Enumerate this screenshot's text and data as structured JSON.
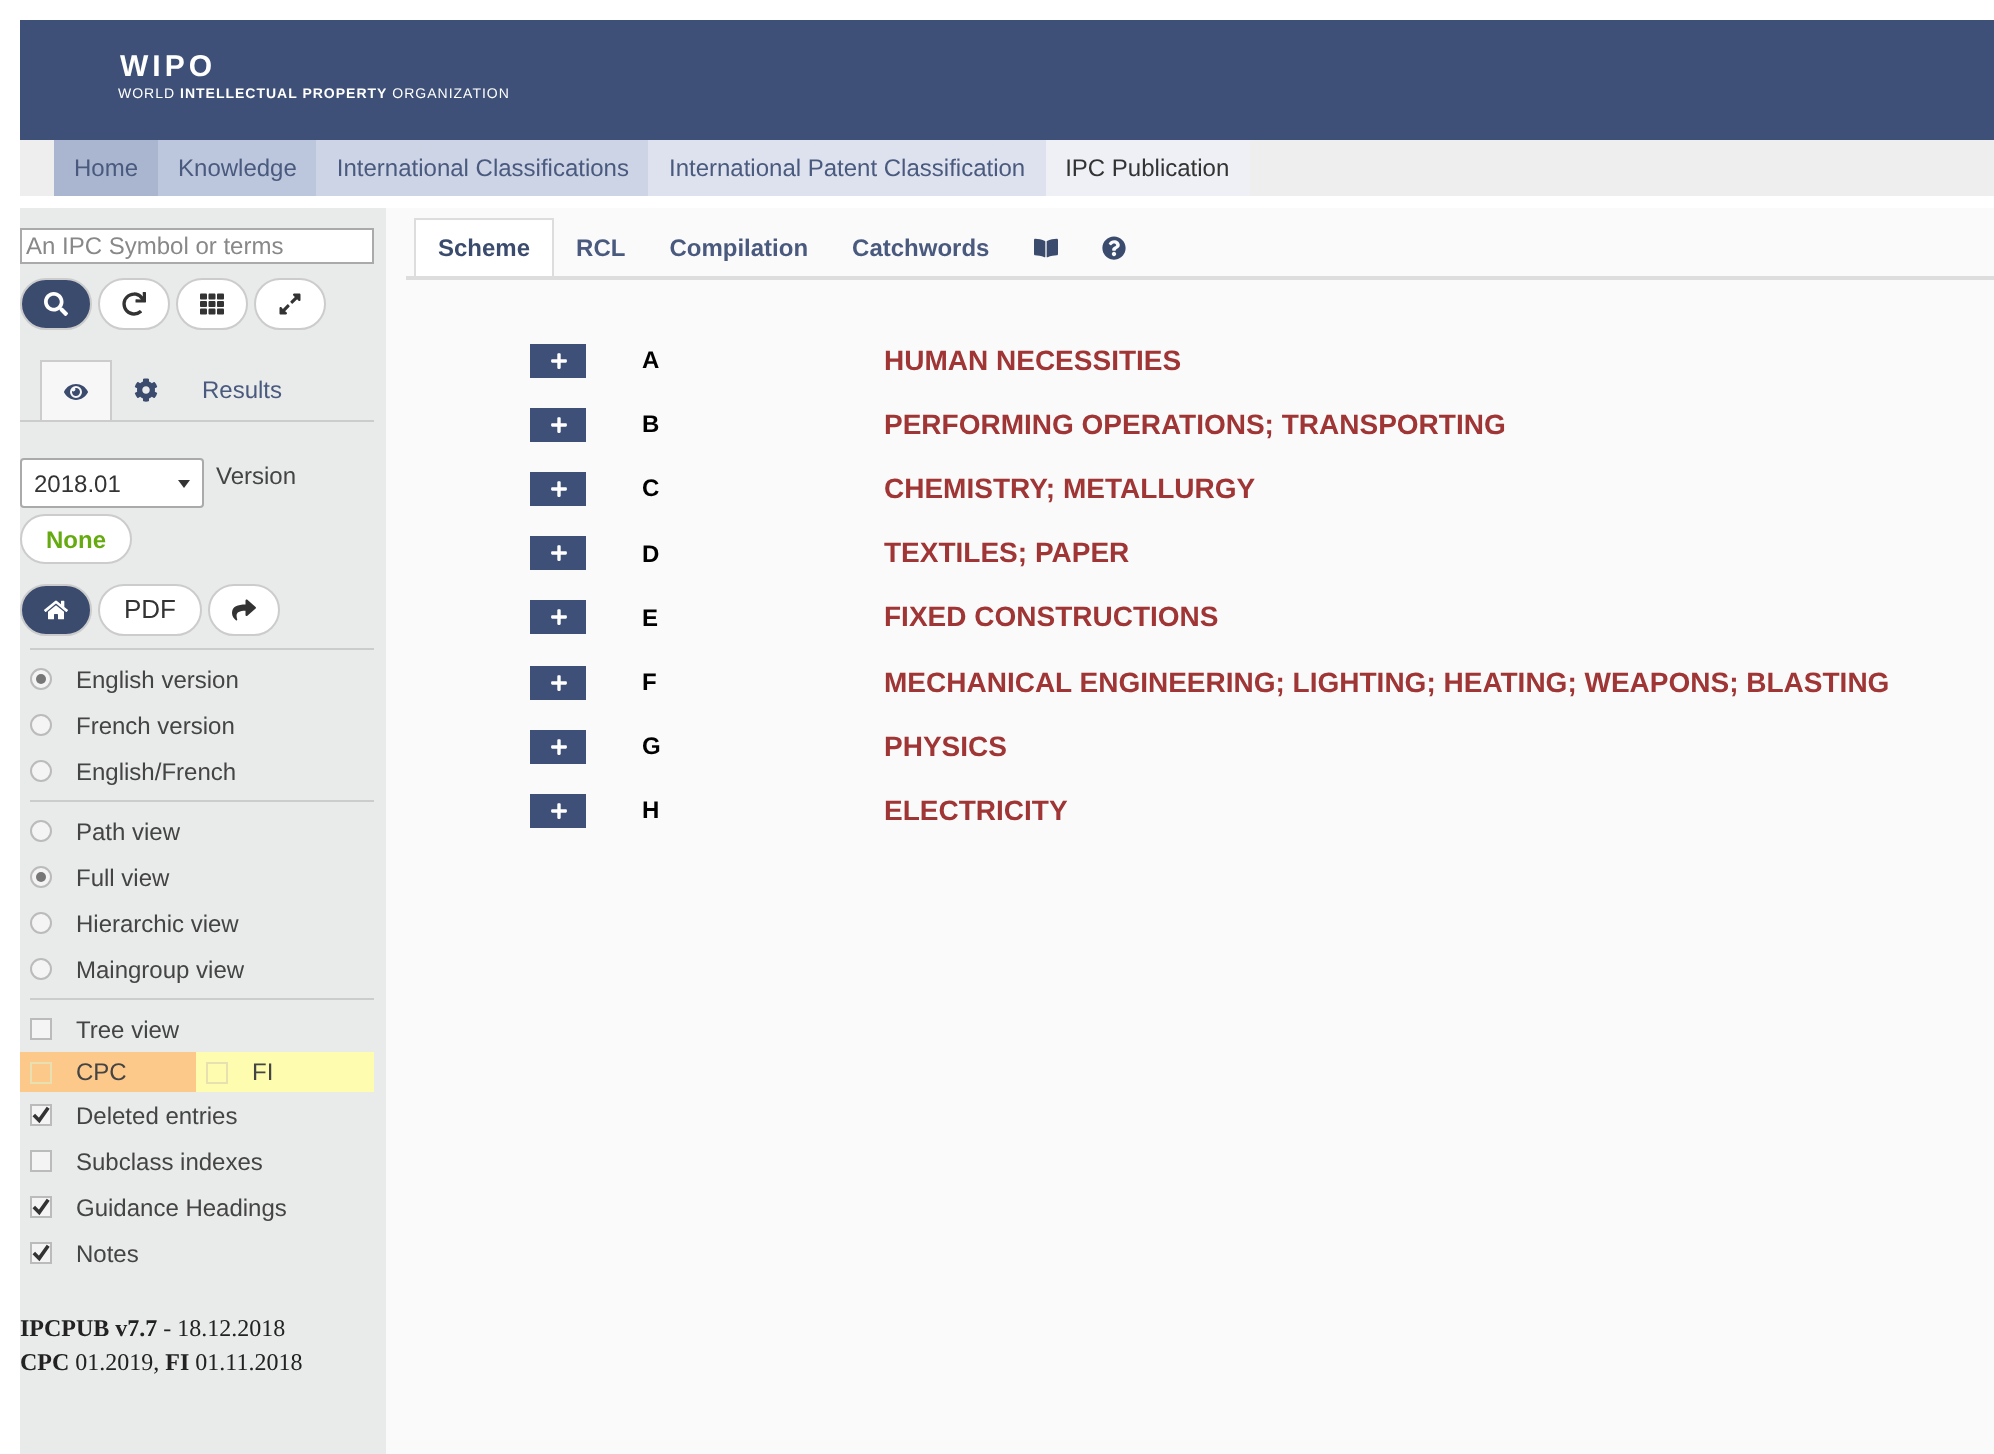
{
  "header": {
    "logo": "WIPO",
    "org": "WORLD **INTELLECTUAL PROPERTY** ORGANIZATION"
  },
  "nav": [
    {
      "label": "Home",
      "color": "#aab6d0",
      "selected": false
    },
    {
      "label": "Knowledge",
      "color": "#bcc6dc",
      "selected": false
    },
    {
      "label": "International Classifications",
      "color": "#ccd4e6",
      "selected": false
    },
    {
      "label": "International Patent Classification",
      "color": "#dde2ee",
      "selected": false
    },
    {
      "label": "IPC Publication",
      "color": "#eef0f6",
      "selected": true
    }
  ],
  "sidebar": {
    "search": {
      "placeholder": "An IPC Symbol or terms"
    },
    "tools": [
      {
        "kind": "search",
        "selected": true
      },
      {
        "kind": "refresh",
        "selected": false
      },
      {
        "kind": "grid",
        "selected": false
      },
      {
        "kind": "expand",
        "selected": false
      }
    ],
    "tabs": [
      {
        "kind": "eye",
        "selected": true
      },
      {
        "kind": "gear",
        "selected": false
      },
      {
        "kind": "text",
        "label": "Results",
        "selected": false
      }
    ],
    "version": {
      "value": "2018.01",
      "label": "Version"
    },
    "none_button": "None",
    "actions": [
      {
        "kind": "home",
        "selected": true
      },
      {
        "kind": "text",
        "label": "PDF",
        "selected": false
      },
      {
        "kind": "share",
        "selected": false
      }
    ],
    "language": [
      {
        "label": "English version",
        "selected": true
      },
      {
        "label": "French version",
        "selected": false
      },
      {
        "label": "English/French",
        "selected": false
      }
    ],
    "view": [
      {
        "label": "Path view",
        "selected": false
      },
      {
        "label": "Full view",
        "selected": true
      },
      {
        "label": "Hierarchic view",
        "selected": false
      },
      {
        "label": "Maingroup view",
        "selected": false
      }
    ],
    "tree_view": {
      "label": "Tree view",
      "checked": false
    },
    "concordance": [
      {
        "label": "CPC",
        "checked": false,
        "color": "#fdc98a"
      },
      {
        "label": "FI",
        "checked": false,
        "color": "#fdfcaf"
      }
    ],
    "options": [
      {
        "label": "Deleted entries",
        "checked": true
      },
      {
        "label": "Subclass indexes",
        "checked": false
      },
      {
        "label": "Guidance Headings",
        "checked": true
      },
      {
        "label": "Notes",
        "checked": true
      }
    ],
    "footer": [
      "**IPCPUB v7.7** - 18.12.2018",
      "**CPC** 01.2019, **FI** 01.11.2018"
    ]
  },
  "main_tabs": [
    {
      "kind": "text",
      "label": "Scheme",
      "selected": true
    },
    {
      "kind": "text",
      "label": "RCL",
      "selected": false
    },
    {
      "kind": "text",
      "label": "Compilation",
      "selected": false
    },
    {
      "kind": "text",
      "label": "Catchwords",
      "selected": false
    },
    {
      "kind": "book",
      "selected": false
    },
    {
      "kind": "help",
      "selected": false
    }
  ],
  "sections": [
    {
      "symbol": "A",
      "title": "HUMAN NECESSITIES",
      "expanded": false
    },
    {
      "symbol": "B",
      "title": "PERFORMING OPERATIONS; TRANSPORTING",
      "expanded": false
    },
    {
      "symbol": "C",
      "title": "CHEMISTRY; METALLURGY",
      "expanded": false
    },
    {
      "symbol": "D",
      "title": "TEXTILES; PAPER",
      "expanded": false
    },
    {
      "symbol": "E",
      "title": "FIXED CONSTRUCTIONS",
      "expanded": false
    },
    {
      "symbol": "F",
      "title": "MECHANICAL ENGINEERING; LIGHTING; HEATING; WEAPONS; BLASTING",
      "expanded": false
    },
    {
      "symbol": "G",
      "title": "PHYSICS",
      "expanded": false
    },
    {
      "symbol": "H",
      "title": "ELECTRICITY",
      "expanded": false
    }
  ]
}
